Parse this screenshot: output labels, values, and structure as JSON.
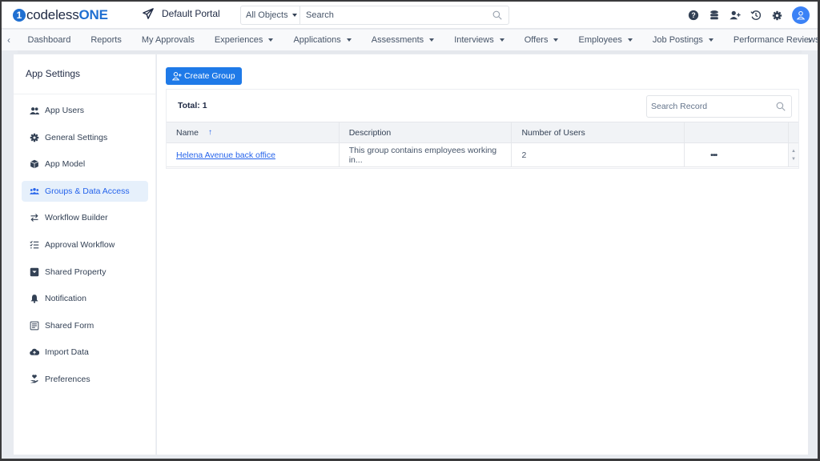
{
  "header": {
    "logo_prefix": "codeless",
    "logo_suffix": "ONE",
    "portal_name": "Default Portal",
    "search_scope": "All Objects",
    "search_placeholder": "Search",
    "icons": [
      "help-icon",
      "database-icon",
      "add-user-icon",
      "history-icon",
      "gear-icon",
      "user-avatar-icon"
    ]
  },
  "nav": {
    "items": [
      {
        "label": "Dashboard",
        "dropdown": false
      },
      {
        "label": "Reports",
        "dropdown": false
      },
      {
        "label": "My Approvals",
        "dropdown": false
      },
      {
        "label": "Experiences",
        "dropdown": true
      },
      {
        "label": "Applications",
        "dropdown": true
      },
      {
        "label": "Assessments",
        "dropdown": true
      },
      {
        "label": "Interviews",
        "dropdown": true
      },
      {
        "label": "Offers",
        "dropdown": true
      },
      {
        "label": "Employees",
        "dropdown": true
      },
      {
        "label": "Job Postings",
        "dropdown": true
      },
      {
        "label": "Performance Reviews",
        "dropdown": true
      }
    ],
    "prev_arrow": "‹",
    "next_arrow": "›"
  },
  "sidebar": {
    "title": "App Settings",
    "items": [
      {
        "label": "App Users",
        "icon": "users-icon",
        "active": false
      },
      {
        "label": "General Settings",
        "icon": "gear-icon",
        "active": false
      },
      {
        "label": "App Model",
        "icon": "cube-icon",
        "active": false
      },
      {
        "label": "Groups & Data Access",
        "icon": "group-icon",
        "active": true
      },
      {
        "label": "Workflow Builder",
        "icon": "swap-arrows-icon",
        "active": false
      },
      {
        "label": "Approval Workflow",
        "icon": "checklist-icon",
        "active": false
      },
      {
        "label": "Shared Property",
        "icon": "inbox-icon",
        "active": false
      },
      {
        "label": "Notification",
        "icon": "bell-icon",
        "active": false
      },
      {
        "label": "Shared Form",
        "icon": "form-icon",
        "active": false
      },
      {
        "label": "Import Data",
        "icon": "cloud-upload-icon",
        "active": false
      },
      {
        "label": "Preferences",
        "icon": "hand-heart-icon",
        "active": false
      }
    ]
  },
  "main": {
    "create_button": "Create Group",
    "total_label": "Total: 1",
    "search_placeholder": "Search Record",
    "columns": [
      "Name",
      "Description",
      "Number of Users",
      ""
    ],
    "sort_indicator": "↑",
    "rows": [
      {
        "name": "Helena Avenue back office",
        "description": "This group contains employees working in...",
        "users": "2",
        "actions": "•••"
      }
    ]
  },
  "colors": {
    "accent": "#1f7ae8",
    "link": "#2563eb",
    "active_bg": "#e6f0fb",
    "logo_blue": "#1f6fd1"
  }
}
